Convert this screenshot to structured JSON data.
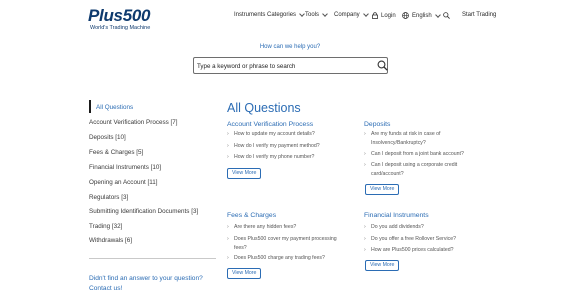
{
  "header": {
    "logo_text": "Plus500",
    "logo_tagline": "World's Trading Machine",
    "nav": {
      "instruments": "Instruments Categories",
      "tools": "Tools",
      "company": "Company",
      "login": "Login",
      "language": "English",
      "start": "Start Trading"
    }
  },
  "help": {
    "label": "How can we help you?",
    "search_placeholder": "Type a keyword or phrase to search"
  },
  "sidebar": {
    "items": [
      {
        "label": "All Questions"
      },
      {
        "label": "Account Verification Process  [7]"
      },
      {
        "label": "Deposits  [10]"
      },
      {
        "label": "Fees & Charges  [5]"
      },
      {
        "label": "Financial Instruments  [10]"
      },
      {
        "label": "Opening an Account  [11]"
      },
      {
        "label": "Regulators  [3]"
      },
      {
        "label": "Submitting Identification Documents  [3]"
      },
      {
        "label": "Trading  [32]"
      },
      {
        "label": "Withdrawals  [6]"
      }
    ],
    "cta_line1": "Didn't find an answer to your question?",
    "cta_line2": "Contact us!"
  },
  "main": {
    "title": "All Questions",
    "view_more": "View More",
    "categories": [
      {
        "title": "Account Verification Process",
        "questions": [
          "How to update my account details?",
          "How do I verify my payment method?",
          "How do I verify my phone number?"
        ]
      },
      {
        "title": "Deposits",
        "questions": [
          "Are my funds at risk in case of Insolvency/Bankruptcy?",
          "Can I deposit from a joint bank account?",
          "Can I deposit using a corporate credit card/account?"
        ]
      },
      {
        "title": "Fees & Charges",
        "questions": [
          "Are there any hidden fees?",
          "Does Plus500 cover my payment processing fees?",
          "Does Plus500 charge any trading fees?"
        ]
      },
      {
        "title": "Financial Instruments",
        "questions": [
          "Do you add dividends?",
          "Do you offer a free Rollover Service?",
          "How are Plus500 prices calculated?"
        ]
      }
    ]
  },
  "colors": {
    "accent": "#2b6cb4",
    "brand": "#0e3a6e"
  }
}
